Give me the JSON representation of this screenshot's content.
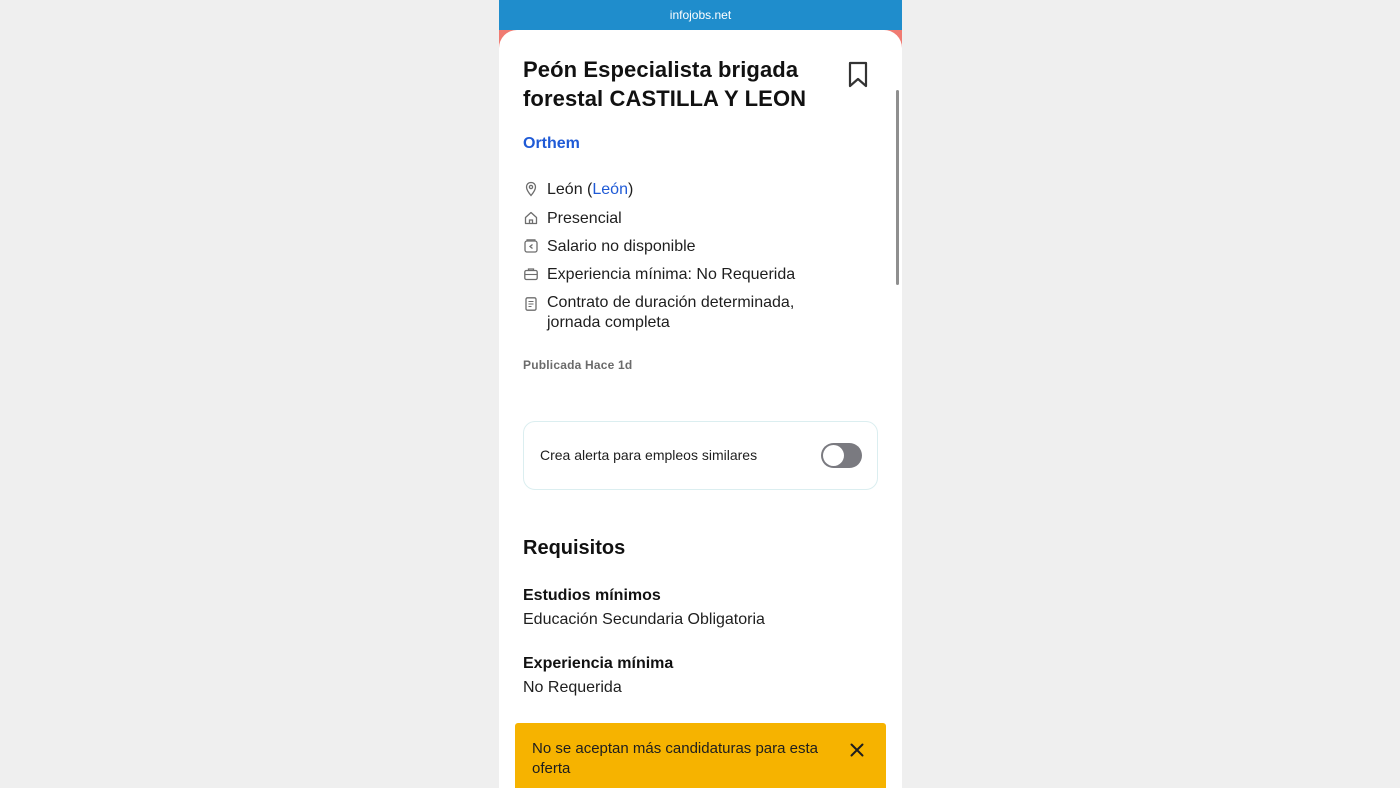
{
  "browser": {
    "url": "infojobs.net"
  },
  "job": {
    "title": "Peón Especialista brigada forestal CASTILLA Y LEON",
    "company": "Orthem",
    "location_city": "León",
    "location_province": "León",
    "modality": "Presencial",
    "salary": "Salario no disponible",
    "experience": "Experiencia mínima: No Requerida",
    "contract_line1": "Contrato de duración determinada,",
    "contract_line2": "jornada completa",
    "published": "Publicada Hace 1d"
  },
  "alert": {
    "label": "Crea alerta para empleos similares",
    "enabled": false
  },
  "requirements": {
    "title": "Requisitos",
    "education_label": "Estudios mínimos",
    "education_value": "Educación Secundaria Obligatoria",
    "experience_label": "Experiencia mínima",
    "experience_value": "No Requerida"
  },
  "banner": {
    "text": "No se aceptan más candidaturas para esta oferta"
  },
  "icons": {
    "bookmark": "bookmark-icon",
    "location": "location-pin-icon",
    "modality": "home-icon",
    "salary": "wallet-icon",
    "experience": "briefcase-icon",
    "contract": "document-icon",
    "close": "close-icon"
  },
  "colors": {
    "url_bar": "#1f8dcc",
    "accent_strip": "#f07b72",
    "link": "#1f5ad6",
    "banner": "#f6b300",
    "toggle_off": "#7a7a80"
  }
}
